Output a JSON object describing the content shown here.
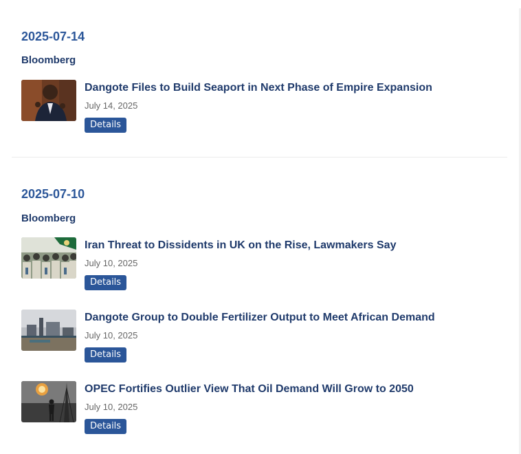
{
  "groups": [
    {
      "date": "2025-07-14",
      "source": "Bloomberg",
      "items": [
        {
          "headline": "Dangote Files to Build Seaport in Next Phase of Empire Expansion",
          "date": "July 14, 2025",
          "button": "Details",
          "thumb": "man-speaking-photo"
        }
      ]
    },
    {
      "date": "2025-07-10",
      "source": "Bloomberg",
      "items": [
        {
          "headline": "Iran Threat to Dissidents in UK on the Rise, Lawmakers Say",
          "date": "July 10, 2025",
          "button": "Details",
          "thumb": "crowd-with-flags-photo"
        },
        {
          "headline": "Dangote Group to Double Fertilizer Output to Meet African Demand",
          "date": "July 10, 2025",
          "button": "Details",
          "thumb": "industrial-plant-photo"
        },
        {
          "headline": "OPEC Fortifies Outlier View That Oil Demand Will Grow to 2050",
          "date": "July 10, 2025",
          "button": "Details",
          "thumb": "worker-and-flare-photo"
        }
      ]
    }
  ]
}
